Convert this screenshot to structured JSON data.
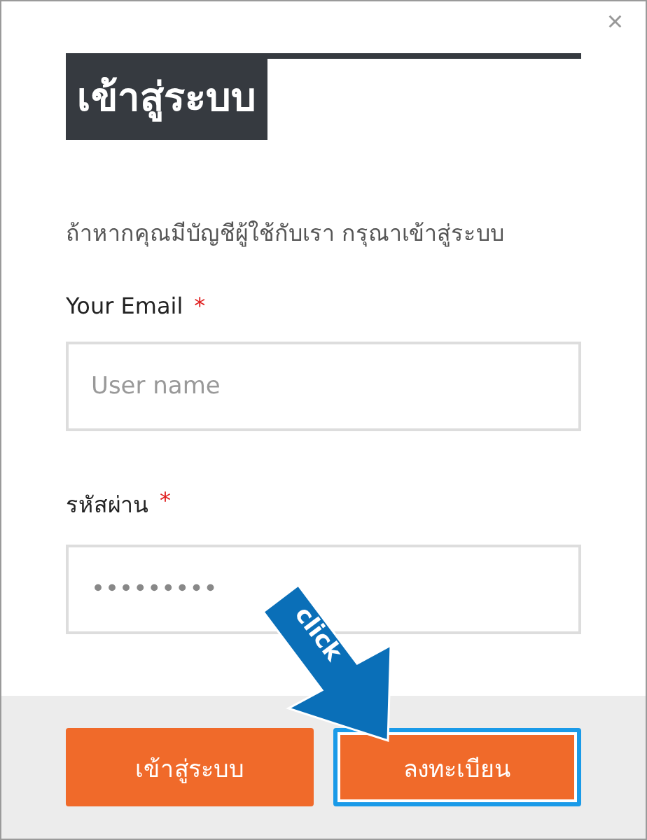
{
  "dialog": {
    "close": "×",
    "title": "เข้าสู่ระบบ",
    "intro": "ถ้าหากคุณมีบัญชีผู้ใช้กับเรา กรุณาเข้าสู่ระบบ"
  },
  "fields": [
    {
      "label": "Your Email",
      "required": "*",
      "placeholder": "User name"
    },
    {
      "label": "รหัสผ่าน",
      "required": "*",
      "value": "•••••••••"
    }
  ],
  "buttons": [
    {
      "label": "เข้าสู่ระบบ",
      "focused": false
    },
    {
      "label": "ลงทะเบียน",
      "focused": true
    }
  ],
  "annotation": {
    "text": "click"
  }
}
